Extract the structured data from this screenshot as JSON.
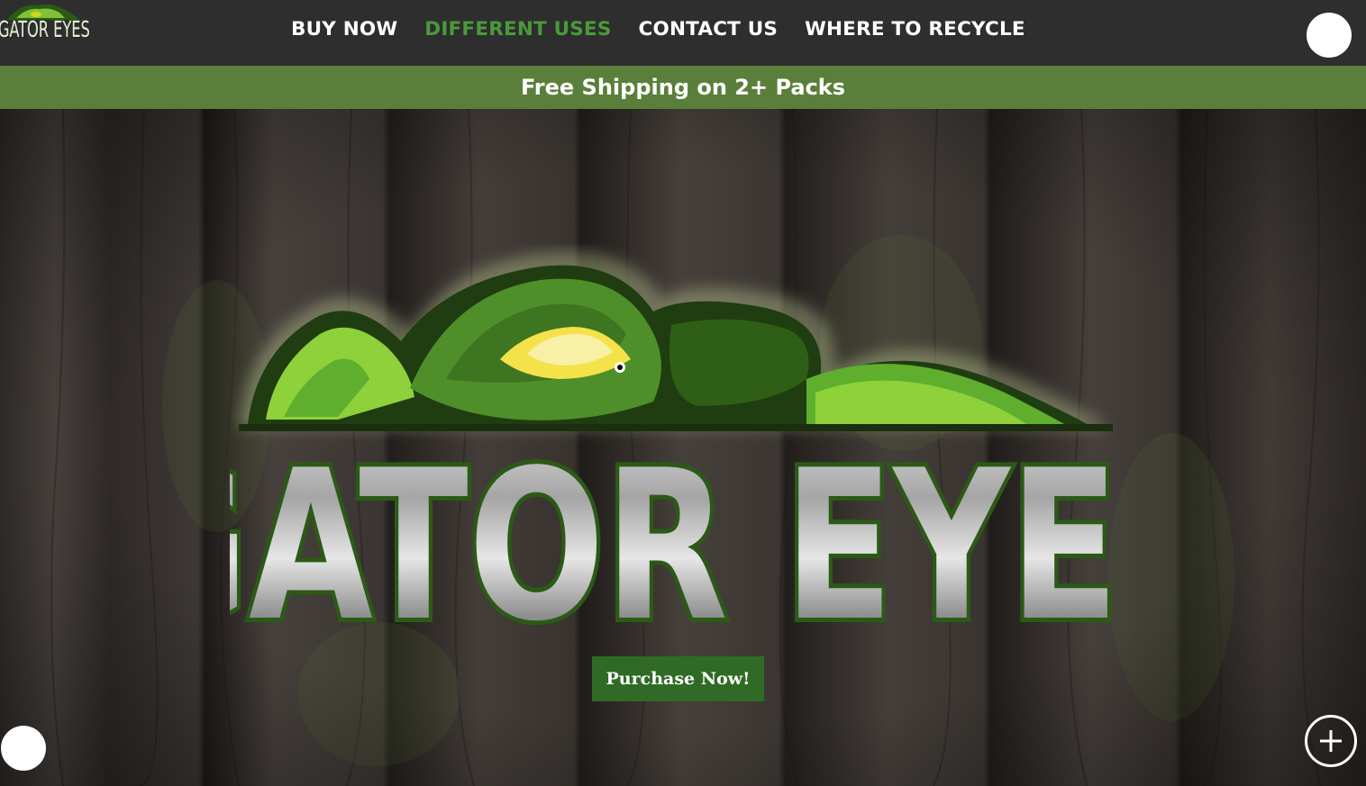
{
  "header": {
    "brand_text": "GATOR EYES",
    "nav_links": [
      {
        "label": "BUY NOW",
        "active": false
      },
      {
        "label": "DIFFERENT USES",
        "active": true
      },
      {
        "label": "CONTACT US",
        "active": false
      },
      {
        "label": "WHERE TO RECYCLE",
        "active": false
      }
    ],
    "account_icon": "account-circle-icon"
  },
  "promo": {
    "text": "Free Shipping on 2+ Packs"
  },
  "hero": {
    "logo_text": "GATOR EYES",
    "cta_label": "Purchase Now!"
  },
  "widgets": {
    "chat_icon": "chat-bubble-icon",
    "expand_icon": "plus-icon"
  },
  "colors": {
    "nav_bg": "#2e2e2e",
    "nav_active": "#4a9a3a",
    "promo_bg": "#5a7f3a",
    "cta_bg": "#2f6b24",
    "gator_green": "#5fae2e"
  }
}
